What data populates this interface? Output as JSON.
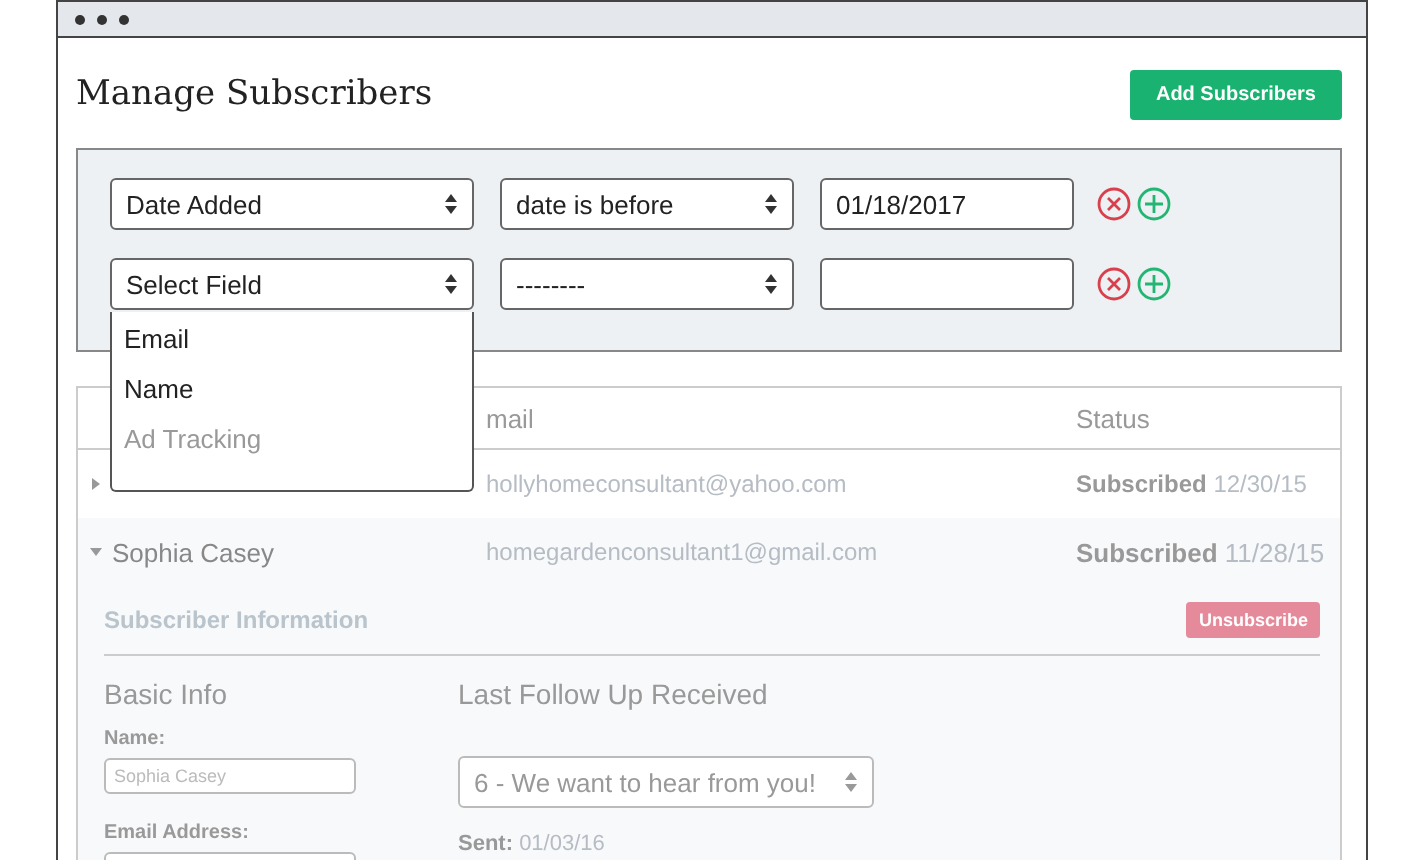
{
  "header": {
    "title": "Manage Subscribers",
    "add_button": "Add Subscribers"
  },
  "filters": [
    {
      "field": "Date Added",
      "operator": "date is before",
      "value": "01/18/2017"
    },
    {
      "field": "Select Field",
      "operator": "--------"
    }
  ],
  "dropdown": {
    "items": [
      {
        "label": "Email",
        "disabled": false
      },
      {
        "label": "Name",
        "disabled": false
      },
      {
        "label": "Ad Tracking",
        "disabled": true
      }
    ]
  },
  "table": {
    "columns": [
      "mail",
      "Status"
    ],
    "rows": [
      {
        "email": "hollyhomeconsultant@yahoo.com",
        "status": "Subscribed",
        "date": "12/30/15",
        "expanded": false
      },
      {
        "name": "Sophia Casey",
        "email": "homegardenconsultant1@gmail.com",
        "status": "Subscribed",
        "date": "11/28/15",
        "expanded": true
      }
    ]
  },
  "details": {
    "section_title": "Subscriber Information",
    "unsubscribe": "Unsubscribe",
    "basic_info": {
      "heading": "Basic Info",
      "fields": [
        {
          "label": "Name:",
          "value": "Sophia Casey"
        },
        {
          "label": "Email Address:"
        }
      ]
    },
    "follow_up": {
      "heading": "Last Follow Up Received",
      "select": "6 - We want to hear from you!",
      "sent_label": "Sent:",
      "sent_date": "01/03/16"
    }
  }
}
